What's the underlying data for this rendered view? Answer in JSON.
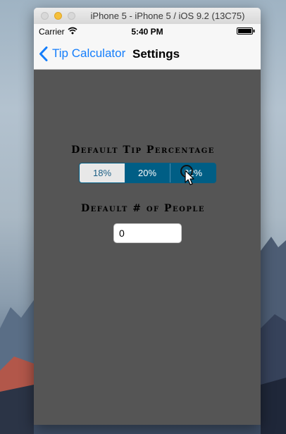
{
  "window": {
    "title": "iPhone 5 - iPhone 5 / iOS 9.2 (13C75)"
  },
  "status_bar": {
    "carrier": "Carrier",
    "time": "5:40 PM"
  },
  "nav": {
    "back_label": "Tip Calculator",
    "title": "Settings"
  },
  "settings": {
    "tip_label": "Default Tip Percentage",
    "tip_options": [
      "18%",
      "20%",
      "22%"
    ],
    "tip_selected": "20%",
    "people_label": "Default # of People",
    "people_value": "0"
  },
  "colors": {
    "accent": "#157efb",
    "segment_selected": "#005e85",
    "screen_background": "#555555"
  },
  "icons": [
    "wifi-icon",
    "battery-icon",
    "chevron-left-icon",
    "mouse-cursor-icon"
  ]
}
